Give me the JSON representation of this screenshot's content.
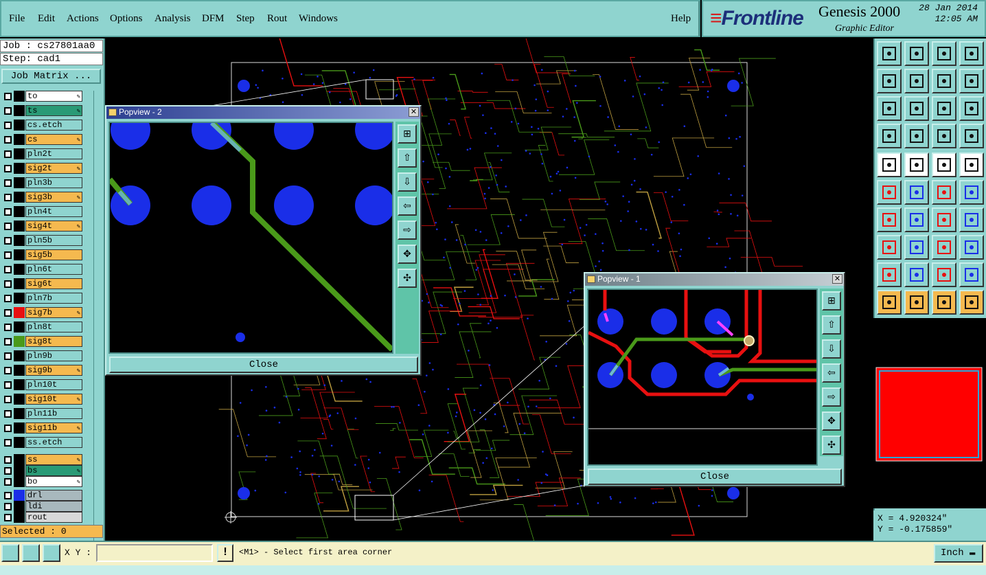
{
  "menu": {
    "items": [
      "File",
      "Edit",
      "Actions",
      "Options",
      "Analysis",
      "DFM",
      "Step",
      "Rout",
      "Windows"
    ],
    "help": "Help"
  },
  "brand": {
    "logo": "Frontline",
    "product": "Genesis 2000",
    "editor": "Graphic Editor",
    "date": "28 Jan 2014",
    "time": "12:05 AM"
  },
  "job": {
    "job_label": "Job : cs27801aa0",
    "step_label": "Step: cad1",
    "matrix_button": "Job Matrix ..."
  },
  "layers": [
    {
      "name": "to",
      "cls": "c-w",
      "edit": true,
      "swatch": ""
    },
    {
      "name": "ts",
      "cls": "c-g",
      "edit": true,
      "swatch": ""
    },
    {
      "name": "cs.etch",
      "cls": "c-pln",
      "edit": false,
      "swatch": ""
    },
    {
      "name": "cs",
      "cls": "c-sig",
      "edit": true,
      "swatch": ""
    },
    {
      "name": "pln2t",
      "cls": "c-pln",
      "edit": false,
      "swatch": ""
    },
    {
      "name": "sig2t",
      "cls": "c-sig",
      "edit": true,
      "swatch": ""
    },
    {
      "name": "pln3b",
      "cls": "c-pln",
      "edit": false,
      "swatch": ""
    },
    {
      "name": "sig3b",
      "cls": "c-sig",
      "edit": true,
      "swatch": ""
    },
    {
      "name": "pln4t",
      "cls": "c-pln",
      "edit": false,
      "swatch": ""
    },
    {
      "name": "sig4t",
      "cls": "c-sig",
      "edit": true,
      "swatch": ""
    },
    {
      "name": "pln5b",
      "cls": "c-pln",
      "edit": false,
      "swatch": ""
    },
    {
      "name": "sig5b",
      "cls": "c-sig",
      "edit": false,
      "swatch": ""
    },
    {
      "name": "pln6t",
      "cls": "c-pln",
      "edit": false,
      "swatch": ""
    },
    {
      "name": "sig6t",
      "cls": "c-sig",
      "edit": false,
      "swatch": ""
    },
    {
      "name": "pln7b",
      "cls": "c-pln",
      "edit": false,
      "swatch": ""
    },
    {
      "name": "sig7b",
      "cls": "c-sig",
      "edit": true,
      "swatch": "#e81010"
    },
    {
      "name": "pln8t",
      "cls": "c-pln",
      "edit": false,
      "swatch": ""
    },
    {
      "name": "sig8t",
      "cls": "c-sig",
      "edit": false,
      "swatch": "#4a9a1a"
    },
    {
      "name": "pln9b",
      "cls": "c-pln",
      "edit": false,
      "swatch": ""
    },
    {
      "name": "sig9b",
      "cls": "c-sig",
      "edit": true,
      "swatch": ""
    },
    {
      "name": "pln10t",
      "cls": "c-pln",
      "edit": false,
      "swatch": ""
    },
    {
      "name": "sig10t",
      "cls": "c-sig",
      "edit": true,
      "swatch": ""
    },
    {
      "name": "pln11b",
      "cls": "c-pln",
      "edit": false,
      "swatch": ""
    },
    {
      "name": "sig11b",
      "cls": "c-sig",
      "edit": true,
      "swatch": ""
    },
    {
      "name": "ss.etch",
      "cls": "c-pln",
      "edit": false,
      "swatch": ""
    },
    {
      "name": "ss",
      "cls": "c-sig",
      "edit": true,
      "swatch": ""
    },
    {
      "name": "bs",
      "cls": "c-g",
      "edit": true,
      "swatch": ""
    },
    {
      "name": "bo",
      "cls": "c-w",
      "edit": true,
      "swatch": ""
    },
    {
      "name": "drl",
      "cls": "c-gray",
      "edit": false,
      "swatch": "#1a2ee8"
    },
    {
      "name": "ldi",
      "cls": "c-gray",
      "edit": false,
      "swatch": ""
    },
    {
      "name": "rout",
      "cls": "c-lgray",
      "edit": false,
      "swatch": ""
    }
  ],
  "selected_label": "Selected : 0",
  "popview2": {
    "title": "Popview - 2",
    "close": "Close"
  },
  "popview1": {
    "title": "Popview - 1",
    "close": "Close"
  },
  "coords": {
    "x": "X = 4.920324\"",
    "y": "Y = -0.175859\""
  },
  "status": {
    "xy_label": "X Y :",
    "xy_value": "",
    "message": "<M1> - Select first area corner",
    "units": "Inch"
  },
  "colors": {
    "panel": "#8fd4cf",
    "signal_layer": "#f5b94f",
    "trace_red": "#e81010",
    "trace_green": "#4a9a1a",
    "pad_blue": "#1a2ee8",
    "highlight": "#ff40ff"
  }
}
